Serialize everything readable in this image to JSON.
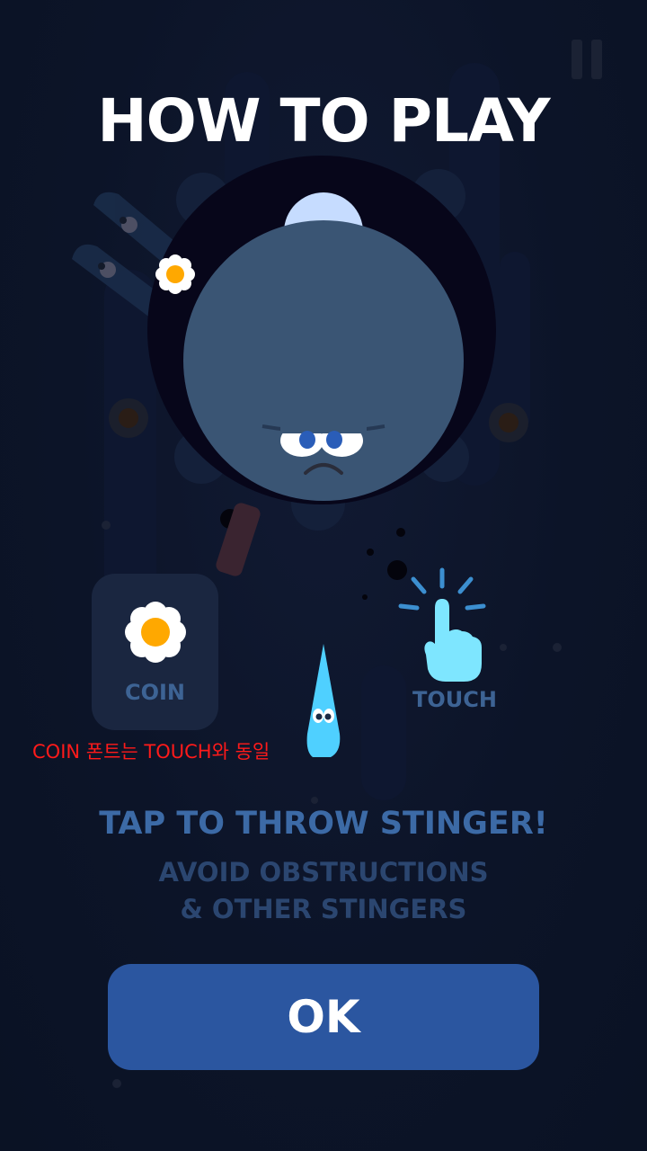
{
  "title": "HOW TO PLAY",
  "coin_label": "COIN",
  "touch_label": "TOUCH",
  "annotation_note": "COIN 폰트는 TOUCH와 동일",
  "instructions": {
    "headline": "TAP TO THROW STINGER!",
    "line1": "AVOID OBSTRUCTIONS",
    "line2": "& OTHER STINGERS"
  },
  "ok_button": {
    "label": "OK"
  },
  "colors": {
    "background": "#0c1428",
    "ball": "#3a5574",
    "ball_ring": "#07061a",
    "coin_petal": "#ffffff",
    "coin_center": "#ffa800",
    "stinger": "#4fd0ff",
    "hand": "#7ee6ff",
    "ok_button": "#2b56a0",
    "headline_text": "#3c6aa6",
    "note_text": "#ff1a1a"
  },
  "icons": [
    "pause-icon",
    "coin-flower-icon",
    "stinger-icon",
    "touch-hand-icon"
  ]
}
